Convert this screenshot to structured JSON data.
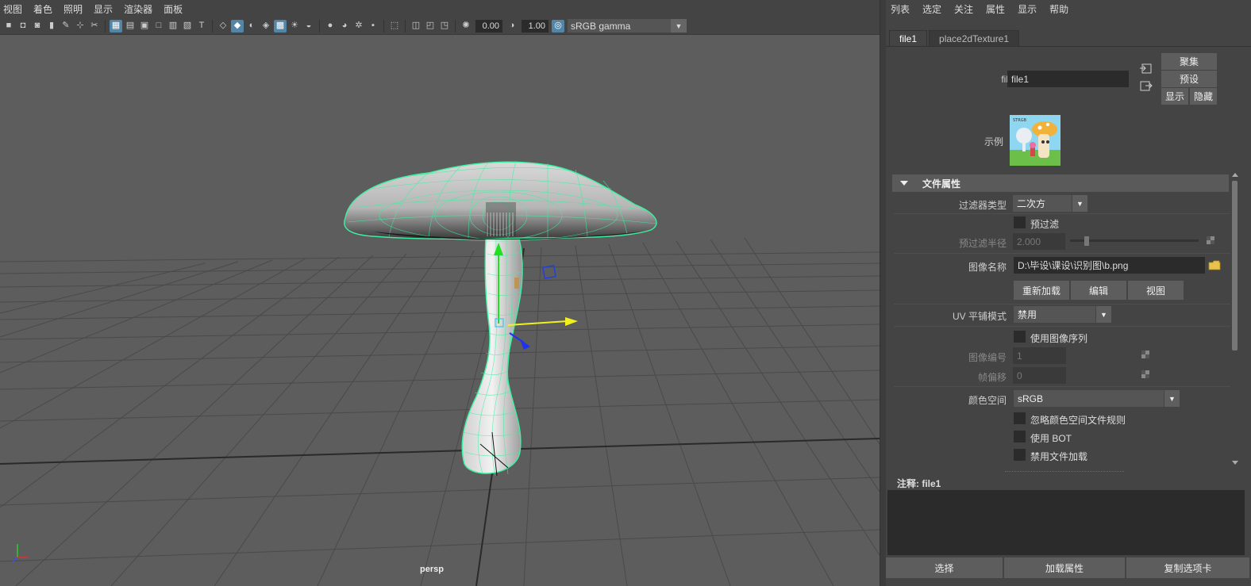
{
  "viewport": {
    "menu": [
      "视图",
      "着色",
      "照明",
      "显示",
      "渲染器",
      "面板"
    ],
    "exposure_value": "0.00",
    "gamma_value": "1.00",
    "color_space": "sRGB gamma",
    "camera_label": "persp"
  },
  "attribute_editor": {
    "menu": [
      "列表",
      "选定",
      "关注",
      "属性",
      "显示",
      "帮助"
    ],
    "tabs": [
      "file1",
      "place2dTexture1"
    ],
    "node_label": "file:",
    "node_name": "file1",
    "buttons": {
      "focus": "聚集",
      "presets": "预设",
      "show": "显示",
      "hide": "隐藏"
    },
    "sample_label": "示例",
    "sample_thumb_text": "STRGB",
    "section_title": "文件属性",
    "filter_type_label": "过滤器类型",
    "filter_type_value": "二次方",
    "prefilter_label": "预过滤",
    "prefilter_radius_label": "预过滤半径",
    "prefilter_radius_value": "2.000",
    "image_name_label": "图像名称",
    "image_name_value": "D:\\毕设\\课设\\识别图\\b.png",
    "reload_button": "重新加载",
    "edit_button": "编辑",
    "view_button": "视图",
    "uv_tiling_label": "UV 平铺模式",
    "uv_tiling_value": "禁用",
    "use_image_sequence_label": "使用图像序列",
    "image_number_label": "图像编号",
    "image_number_value": "1",
    "frame_offset_label": "帧偏移",
    "frame_offset_value": "0",
    "color_space_label": "颜色空间",
    "color_space_value": "sRGB",
    "ignore_cs_rules_label": "忽略颜色空间文件规则",
    "use_bot_label": "使用 BOT",
    "disable_file_load_label": "禁用文件加载",
    "notes_label": "注释:",
    "notes_node": "file1",
    "bottom_buttons": [
      "选择",
      "加载属性",
      "复制选项卡"
    ]
  }
}
